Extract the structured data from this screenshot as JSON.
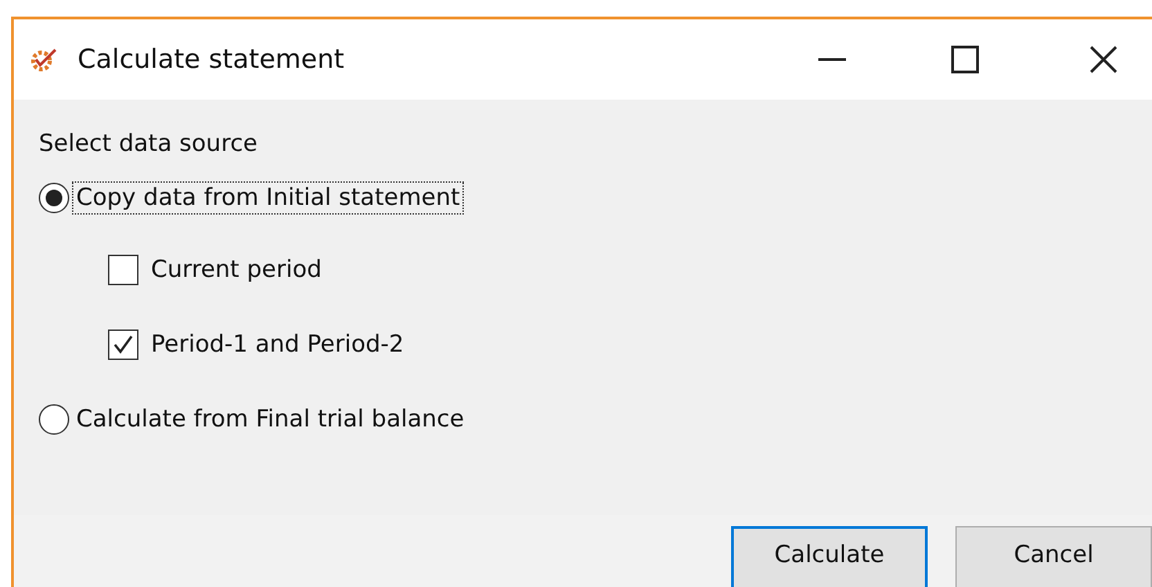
{
  "window": {
    "title": "Calculate statement"
  },
  "group_label": "Select data source",
  "options": [
    {
      "kind": "radio",
      "label": "Copy data from Initial statement",
      "selected": true,
      "focused": true,
      "children": [
        {
          "kind": "checkbox",
          "label": "Current period",
          "checked": false
        },
        {
          "kind": "checkbox",
          "label": "Period-1 and Period-2",
          "checked": true
        }
      ]
    },
    {
      "kind": "radio",
      "label": "Calculate from Final trial balance",
      "selected": false,
      "focused": false
    }
  ],
  "buttons": [
    {
      "label": "Calculate",
      "default": true
    },
    {
      "label": "Cancel",
      "default": false
    }
  ]
}
